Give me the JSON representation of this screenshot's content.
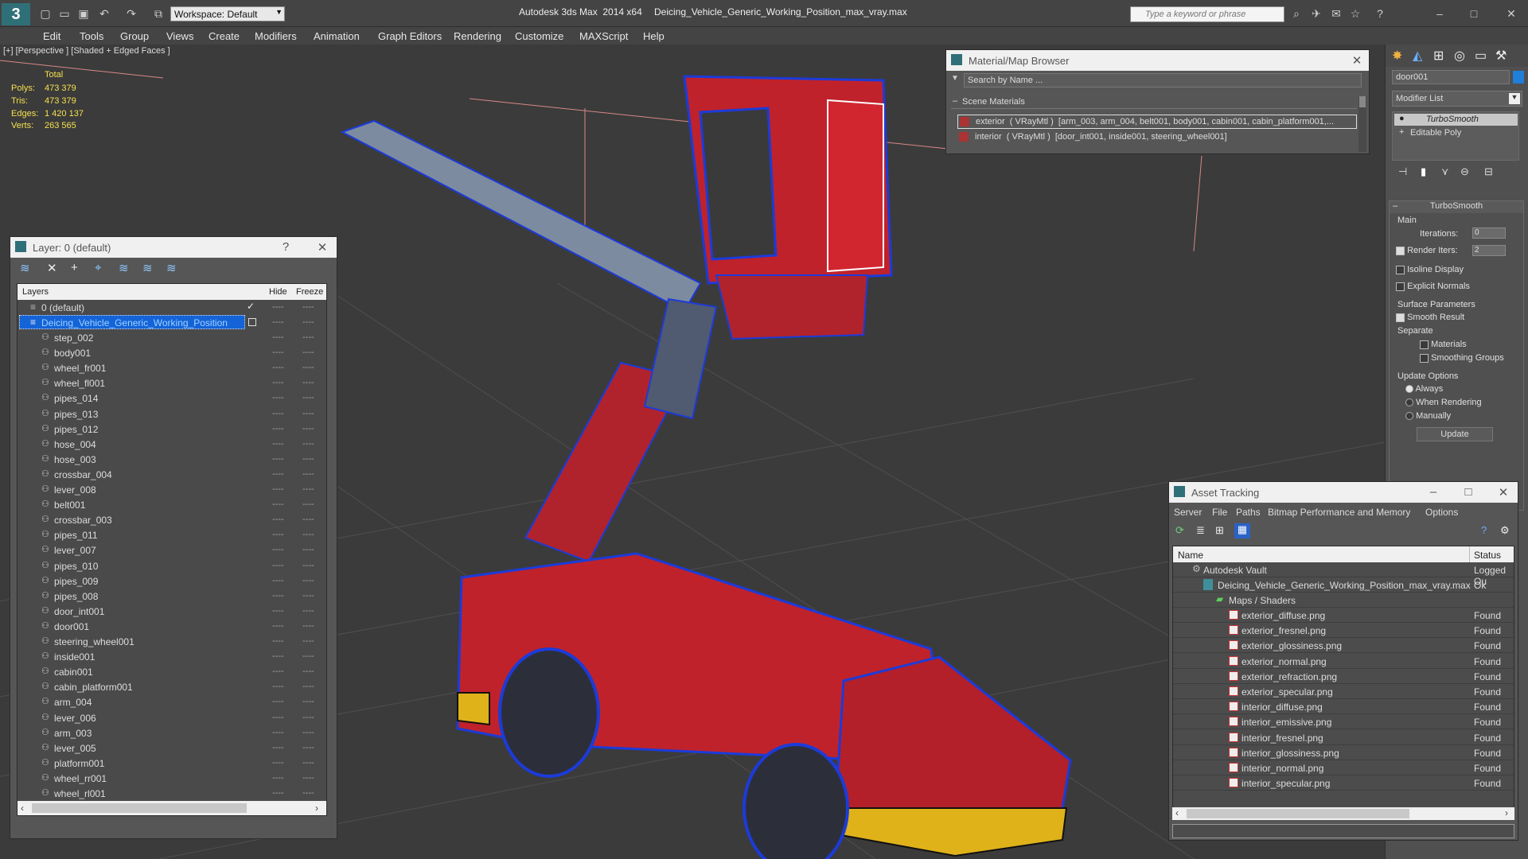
{
  "titlebar": {
    "workspace": "Workspace: Default",
    "app_title": "Autodesk 3ds Max  2014 x64",
    "file_title": "Deicing_Vehicle_Generic_Working_Position_max_vray.max",
    "search_placeholder": "Type a keyword or phrase"
  },
  "menu": [
    "Edit",
    "Tools",
    "Group",
    "Views",
    "Create",
    "Modifiers",
    "Animation",
    "Graph Editors",
    "Rendering",
    "Customize",
    "MAXScript",
    "Help"
  ],
  "viewport": {
    "label": "[+] [Perspective ] [Shaded + Edged Faces ]",
    "stats_header": "Total",
    "stats": [
      {
        "label": "Polys:",
        "value": "473 379"
      },
      {
        "label": "Tris:",
        "value": "473 379"
      },
      {
        "label": "Edges:",
        "value": "1 420 137"
      },
      {
        "label": "Verts:",
        "value": "263 565"
      }
    ]
  },
  "layer_panel": {
    "title": "Layer: 0 (default)",
    "help": "?",
    "columns": {
      "layers": "Layers",
      "hide": "Hide",
      "freeze": "Freeze"
    },
    "default_layer": "0 (default)",
    "selected_layer": "Deicing_Vehicle_Generic_Working_Position",
    "objects": [
      "step_002",
      "body001",
      "wheel_fr001",
      "wheel_fl001",
      "pipes_014",
      "pipes_013",
      "pipes_012",
      "hose_004",
      "hose_003",
      "crossbar_004",
      "lever_008",
      "belt001",
      "crossbar_003",
      "pipes_011",
      "lever_007",
      "pipes_010",
      "pipes_009",
      "pipes_008",
      "door_int001",
      "door001",
      "steering_wheel001",
      "inside001",
      "cabin001",
      "cabin_platform001",
      "arm_004",
      "lever_006",
      "arm_003",
      "lever_005",
      "platform001",
      "wheel_rr001",
      "wheel_rl001",
      "Deicing_Vehicle_Generic_Working_Position"
    ],
    "dash": "----"
  },
  "material_browser": {
    "title": "Material/Map Browser",
    "search_placeholder": "Search by Name ...",
    "section": "Scene Materials",
    "materials": [
      "exterior  ( VRayMtl )  [arm_003, arm_004, belt001, body001, cabin001, cabin_platform001,...",
      "interior  ( VRayMtl )  [door_int001, inside001, steering_wheel001]"
    ]
  },
  "command_panel": {
    "object_name": "door001",
    "modifier_list": "Modifier List",
    "stack": [
      "TurboSmooth",
      "Editable Poly"
    ],
    "rollout_title": "TurboSmooth",
    "main_group": "Main",
    "iterations_label": "Iterations:",
    "iterations_value": "0",
    "render_iters_label": "Render Iters:",
    "render_iters_value": "2",
    "isoline": "Isoline Display",
    "explicit": "Explicit Normals",
    "surface_group": "Surface Parameters",
    "smooth_result": "Smooth Result",
    "separate": "Separate",
    "materials": "Materials",
    "smoothing_groups": "Smoothing Groups",
    "update_group": "Update Options",
    "always": "Always",
    "when_rendering": "When Rendering",
    "manually": "Manually",
    "update_button": "Update"
  },
  "asset_tracking": {
    "title": "Asset Tracking",
    "menu": [
      "Server",
      "File",
      "Paths",
      "Bitmap Performance and Memory",
      "Options"
    ],
    "col_name": "Name",
    "col_status": "Status",
    "vault": {
      "name": "Autodesk Vault",
      "status": "Logged Ou"
    },
    "file": {
      "name": "Deicing_Vehicle_Generic_Working_Position_max_vray.max",
      "status": "Ok"
    },
    "maps_group": "Maps / Shaders",
    "maps": [
      {
        "name": "exterior_diffuse.png",
        "status": "Found"
      },
      {
        "name": "exterior_fresnel.png",
        "status": "Found"
      },
      {
        "name": "exterior_glossiness.png",
        "status": "Found"
      },
      {
        "name": "exterior_normal.png",
        "status": "Found"
      },
      {
        "name": "exterior_refraction.png",
        "status": "Found"
      },
      {
        "name": "exterior_specular.png",
        "status": "Found"
      },
      {
        "name": "interior_diffuse.png",
        "status": "Found"
      },
      {
        "name": "interior_emissive.png",
        "status": "Found"
      },
      {
        "name": "interior_fresnel.png",
        "status": "Found"
      },
      {
        "name": "interior_glossiness.png",
        "status": "Found"
      },
      {
        "name": "interior_normal.png",
        "status": "Found"
      },
      {
        "name": "interior_specular.png",
        "status": "Found"
      }
    ]
  }
}
